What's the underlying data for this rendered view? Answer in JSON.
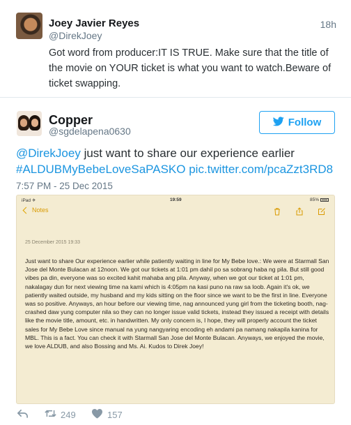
{
  "tweet1": {
    "name": "Joey Javier Reyes",
    "handle": "@DirekJoey",
    "time": "18h",
    "text": "Got word from producer:IT IS TRUE. Make sure that the title of the movie on YOUR ticket is what you want to watch.Beware of ticket swapping."
  },
  "tweet2": {
    "name": "Copper",
    "handle": "@sgdelapena0630",
    "follow_label": "Follow",
    "mention": "@DirekJoey",
    "text_body": " just want to share our experience earlier",
    "hashtag": "#ALDUBMyBebeLoveSaPASKO",
    "pic_link": "pic.twitter.com/pcaZzt3RD8",
    "date": "7:57 PM - 25 Dec 2015",
    "retweets": "249",
    "likes": "157"
  },
  "photo": {
    "status_left": "iPad ✈",
    "status_time": "19:59",
    "status_battery": "85%",
    "back_label": "Notes",
    "note_date": "25 December 2015 19:33",
    "note_text": "Just want to share Our experience earlier while patiently waiting in line for My Bebe love.: We were at Starmall San Jose del Monte Bulacan at 12noon. We got our tickets at 1:01 pm dahil po sa sobrang haba ng pila. But still good vibes pa din, everyone was so excited kahit mahaba ang pila. Anyway, when we got our ticket at 1:01 pm, nakalagay dun for next viewing time na kami which is 4:05pm na kasi puno na raw sa loob. Again it's ok, we patiently waited outside, my husband and my kids sitting on the floor since we want to be the first in line. Everyone was so positive. Anyways, an hour before our viewing time, nag announced yung girl from the ticketing booth, nag-crashed daw yung computer nila so they can no longer issue valid tickets, instead they issued a receipt with details like the movie title, amount, etc. in handwritten. My only concern is, I hope, they will properly account the ticket sales for My Bebe Love since manual na yung nangyaring encoding eh andami pa namang nakapila kanina for MBL. This is a fact. You can check it with Starmall San Jose del Monte Bulacan. Anyways, we enjoyed the movie, we love ALDUB, and also Bossing and Ms. Ai. Kudos to Direk Joey!"
  },
  "icons": [
    "reply-icon",
    "retweet-icon",
    "like-icon",
    "twitter-bird-icon",
    "trash-icon",
    "share-icon",
    "compose-icon",
    "back-chevron-icon"
  ],
  "colors": {
    "link": "#1b95e0",
    "follow": "#1da1f2",
    "secondary_text": "#657786",
    "note_bg": "#f4ecd2",
    "notes_accent": "#d99a00"
  }
}
